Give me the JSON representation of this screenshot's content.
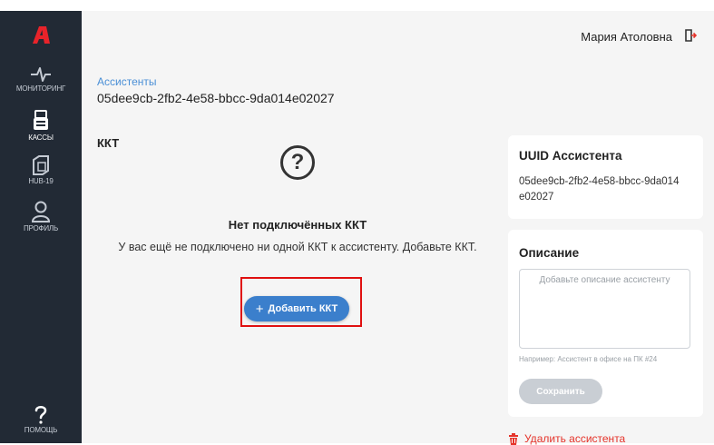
{
  "colors": {
    "sidebar": "#222a35",
    "accent": "#3b7fcc",
    "logo": "#e8232a",
    "danger": "#e5332a",
    "link": "#4a8fd6"
  },
  "sidebar": {
    "logo_icon": "brand-logo-a",
    "items": [
      {
        "label": "МОНИТОРИНГ",
        "icon": "pulse-icon",
        "active": false
      },
      {
        "label": "КАССЫ",
        "icon": "cash-register-icon",
        "active": true
      },
      {
        "label": "HUB-19",
        "icon": "hub-device-icon",
        "active": false
      },
      {
        "label": "ПРОФИЛЬ",
        "icon": "user-icon",
        "active": false
      }
    ],
    "help": {
      "label": "ПОМОЩЬ",
      "icon": "question-mark-icon"
    }
  },
  "topbar": {
    "user_name": "Мария Атоловна",
    "logout_icon": "logout-icon"
  },
  "main": {
    "breadcrumb": "Ассистенты",
    "title": "05dee9cb-2fb2-4e58-bbcc-9da014e02027",
    "section_title": "ККТ",
    "empty_state": {
      "icon": "question-circle-icon",
      "icon_glyph": "?",
      "title": "Нет подключённых ККТ",
      "text": "У вас ещё не подключено ни одной ККТ к ассистенту. Добавьте ККТ.",
      "add_button_icon": "+",
      "add_button_label": "Добавить ККТ"
    }
  },
  "uuid_card": {
    "title": "UUID Ассистента",
    "value": "05dee9cb-2fb2-4e58-bbcc-9da014e02027"
  },
  "description_card": {
    "title": "Описание",
    "placeholder": "Добавьте описание ассистенту",
    "value": "",
    "hint": "Например: Ассистент в офисе на ПК #24",
    "save_label": "Сохранить"
  },
  "delete": {
    "label": "Удалить ассистента",
    "icon": "trash-icon"
  }
}
